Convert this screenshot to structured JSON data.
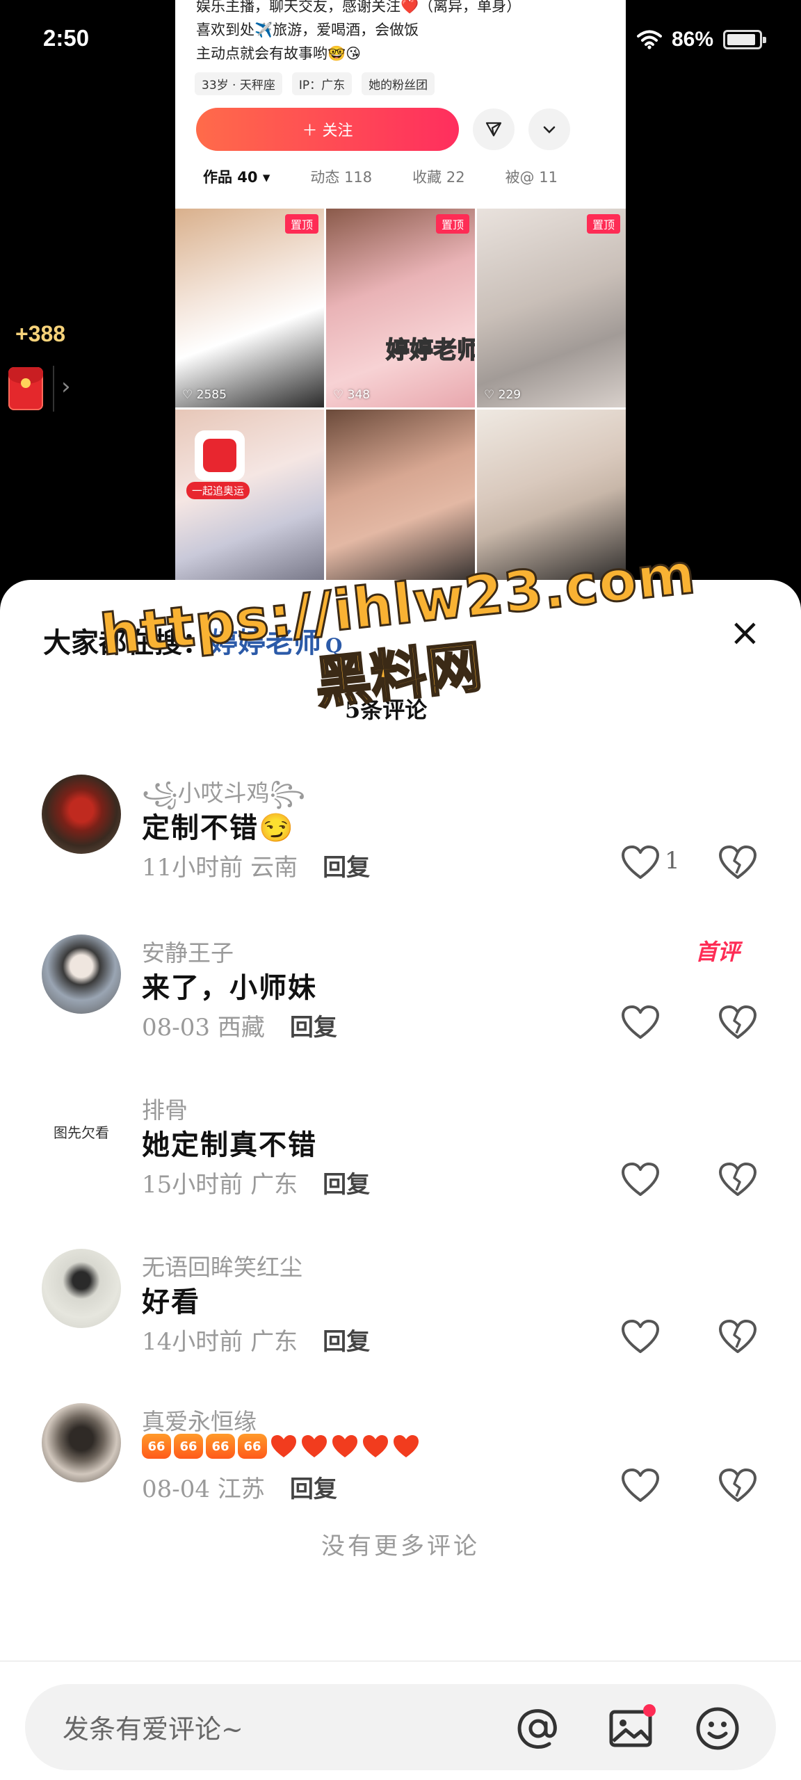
{
  "status_bar": {
    "time": "2:50",
    "battery": "86%"
  },
  "reward": {
    "amount": "+388",
    "chevron": "›"
  },
  "profile_preview": {
    "bio_lines": [
      "娱乐主播，聊天交友，感谢关注❤️（离异，单身）",
      "喜欢到处✈️旅游，爱喝酒，会做饭",
      "主动点就会有故事哟🤓😘"
    ],
    "tags": [
      "33岁 · 天秤座",
      "IP：广东",
      "她的粉丝团"
    ],
    "follow_label": "＋ 关注",
    "tabs": [
      "作品 40 ▾",
      "动态 118",
      "收藏 22",
      "被@ 11"
    ],
    "grid": [
      {
        "pin": "置顶",
        "likes": "♡ 2585"
      },
      {
        "pin": "置顶",
        "likes": "♡ 348",
        "caption": "婷婷老师"
      },
      {
        "pin": "置顶",
        "likes": "♡ 229"
      },
      {
        "run_label": "一起追奥运"
      },
      {},
      {}
    ]
  },
  "sheet": {
    "search_prefix": "大家都在搜：",
    "search_term": "婷婷老师",
    "search_icon": "Q",
    "close": "×",
    "count_title": "5条评论"
  },
  "watermark": {
    "url": "https://ihlw23.com",
    "name": "黑料网"
  },
  "comments": [
    {
      "user": "꧁小哎斗鸡꧂",
      "text": "定制不错😏",
      "time": "11小时前 云南",
      "reply": "回复",
      "likes": "1"
    },
    {
      "user": "安静王子",
      "text": "来了，小师妹",
      "time": "08-03 西藏",
      "reply": "回复",
      "badge": "首评"
    },
    {
      "user": "排骨",
      "text": "她定制真不错",
      "time": "15小时前 广东",
      "reply": "回复",
      "avatar_text": "图先欠看"
    },
    {
      "user": "无语回眸笑红尘",
      "text": "好看",
      "time": "14小时前 广东",
      "reply": "回复"
    },
    {
      "user": "真爱永恒缘",
      "emoji_66": [
        "66",
        "66",
        "66",
        "66"
      ],
      "time": "08-04 江苏",
      "reply": "回复"
    }
  ],
  "no_more": "没有更多评论",
  "input": {
    "placeholder": "发条有爱评论~",
    "at": "@"
  },
  "colors": {
    "accent": "#fe2c55",
    "search_term": "#2b5aa8",
    "watermark": "#f9b233"
  }
}
